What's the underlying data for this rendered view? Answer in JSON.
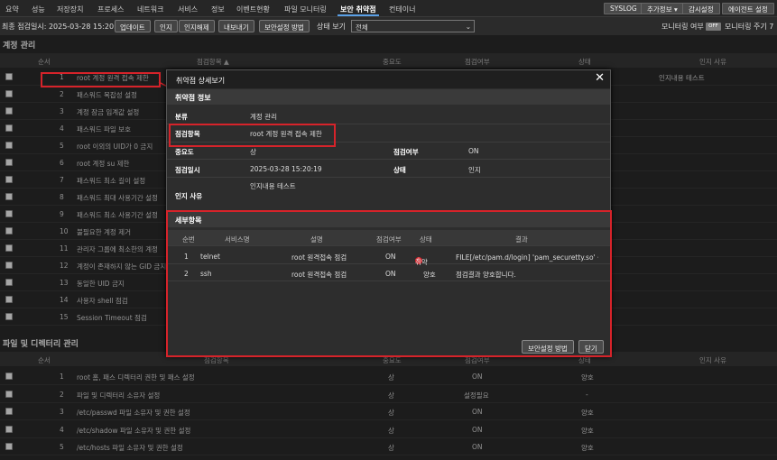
{
  "nav": {
    "tabs": [
      "요약",
      "성능",
      "저장장치",
      "프로세스",
      "네트워크",
      "서비스",
      "정보",
      "이벤트현황",
      "파일 모니터링",
      "보안 취약점",
      "컨테이너"
    ],
    "right_buttons": [
      "SYSLOG",
      "추가정보 ▾",
      "감시설정",
      "에이전트 설정"
    ]
  },
  "toolbar": {
    "last_check": "최종 점검일시: 2025-03-28 15:20:23",
    "buttons": [
      "업데이트",
      "인지",
      "인지해제",
      "내보내기",
      "보안설정 방법"
    ],
    "status_label": "상태 보기",
    "status_value": "전체",
    "monitor_label": "모니터링 여부",
    "monitor_toggle": "OFF",
    "monitor_cycle": "모니터링 주기 7"
  },
  "account_section": {
    "title": "계정 관리",
    "headers": [
      "순서",
      "점검항목 ▲",
      "중요도",
      "점검여부",
      "상태",
      "인지 사유"
    ],
    "rows": [
      {
        "no": "1",
        "item": "root 계정 원격 접속 제한",
        "reason": "인지내용 테스트"
      },
      {
        "no": "2",
        "item": "패스워드 복잡성 설정"
      },
      {
        "no": "3",
        "item": "계정 잠금 임계값 설정"
      },
      {
        "no": "4",
        "item": "패스워드 파일 보호"
      },
      {
        "no": "5",
        "item": "root 이외의 UID가 0 금지"
      },
      {
        "no": "6",
        "item": "root 계정 su 제한"
      },
      {
        "no": "7",
        "item": "패스워드 최소 길이 설정"
      },
      {
        "no": "8",
        "item": "패스워드 최대 사용기간 설정"
      },
      {
        "no": "9",
        "item": "패스워드 최소 사용기간 설정"
      },
      {
        "no": "10",
        "item": "불필요한 계정 제거"
      },
      {
        "no": "11",
        "item": "관리자 그룹에 최소한의 계정"
      },
      {
        "no": "12",
        "item": "계정이 존재하지 않는 GID 금지"
      },
      {
        "no": "13",
        "item": "동일한 UID 금지"
      },
      {
        "no": "14",
        "item": "사용자 shell 점검"
      },
      {
        "no": "15",
        "item": "Session Timeout 점검"
      }
    ]
  },
  "file_section": {
    "title": "파일 및 디렉터리 관리",
    "headers": [
      "순서",
      "점검항목",
      "중요도",
      "점검여부",
      "상태",
      "인지 사유"
    ],
    "rows": [
      {
        "no": "1",
        "item": "root 홈, 패스 디렉터리 권한 및 패스 설정",
        "importance": "상",
        "checked": "ON",
        "status": "양호"
      },
      {
        "no": "2",
        "item": "파일 및 디렉터리 소유자 설정",
        "importance": "상",
        "checked": "설정필요",
        "status": "-"
      },
      {
        "no": "3",
        "item": "/etc/passwd 파일 소유자 및 권한 설정",
        "importance": "상",
        "checked": "ON",
        "status": "양호"
      },
      {
        "no": "4",
        "item": "/etc/shadow 파일 소유자 및 권한 설정",
        "importance": "상",
        "checked": "ON",
        "status": "양호"
      },
      {
        "no": "5",
        "item": "/etc/hosts 파일 소유자 및 권한 설정",
        "importance": "상",
        "checked": "ON",
        "status": "양호"
      }
    ]
  },
  "modal": {
    "title": "취약점 상세보기",
    "info_header": "취약점 정보",
    "labels": {
      "category": "분류",
      "item": "점검항목",
      "importance": "중요도",
      "checked": "점검여부",
      "datetime": "점검일시",
      "status": "상태",
      "reason": "인지 사유"
    },
    "values": {
      "category": "계정 관리",
      "item": "root 계정 원격 접속 제한",
      "importance": "상",
      "checked": "ON",
      "datetime": "2025-03-28 15:20:19",
      "status": "인지",
      "reason": "인지내용 테스트"
    },
    "detail_header": "세부항목",
    "detail_columns": [
      "순번",
      "서비스명",
      "설명",
      "점검여부",
      "상태",
      "결과"
    ],
    "detail_rows": [
      {
        "no": "1",
        "service": "telnet",
        "desc": "root 원격접속 점검",
        "checked": "ON",
        "status": "취약",
        "result": "FILE[/etc/pam.d/login] 'pam_securetty.so' 설정"
      },
      {
        "no": "2",
        "service": "ssh",
        "desc": "root 원격접속 점검",
        "checked": "ON",
        "status": "양호",
        "result": "점검결과 양호합니다."
      }
    ],
    "buttons": {
      "method": "보안설정 방법",
      "close": "닫기"
    }
  },
  "colors": {
    "highlight": "#d6232a",
    "accent": "#5aa0e6"
  }
}
